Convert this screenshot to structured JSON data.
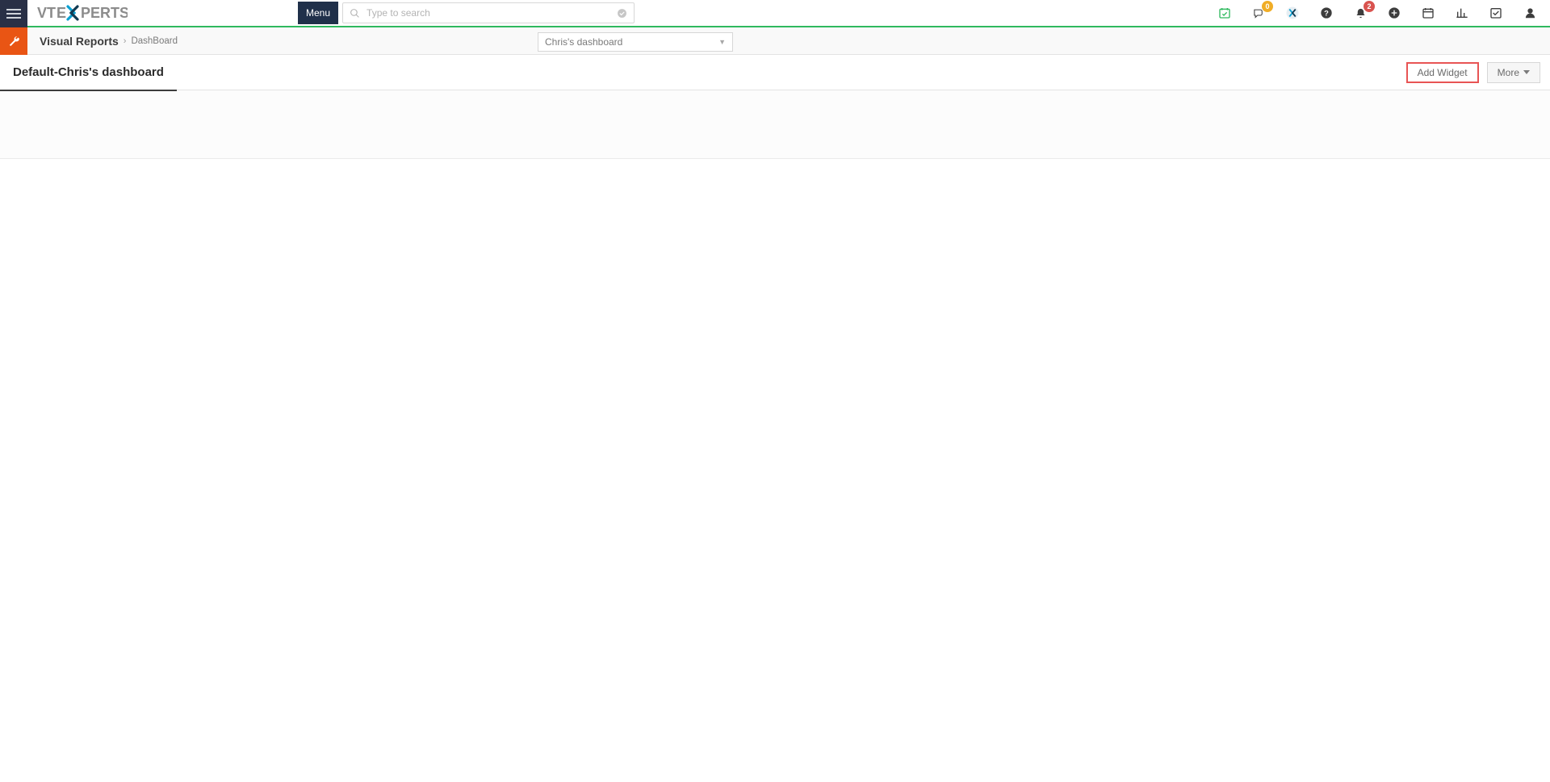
{
  "header": {
    "menu_button_label": "Menu",
    "search_placeholder": "Type to search"
  },
  "notifications": {
    "chat_badge": "0",
    "bell_badge": "2"
  },
  "breadcrumb": {
    "root": "Visual Reports",
    "leaf": "DashBoard"
  },
  "dashboard_selector": {
    "selected": "Chris's dashboard"
  },
  "tab": {
    "active_label": "Default-Chris's dashboard"
  },
  "actions": {
    "add_widget_label": "Add Widget",
    "more_label": "More"
  },
  "logo": {
    "prefix": "VT",
    "mid": "E",
    "suffix": "PERTS"
  }
}
